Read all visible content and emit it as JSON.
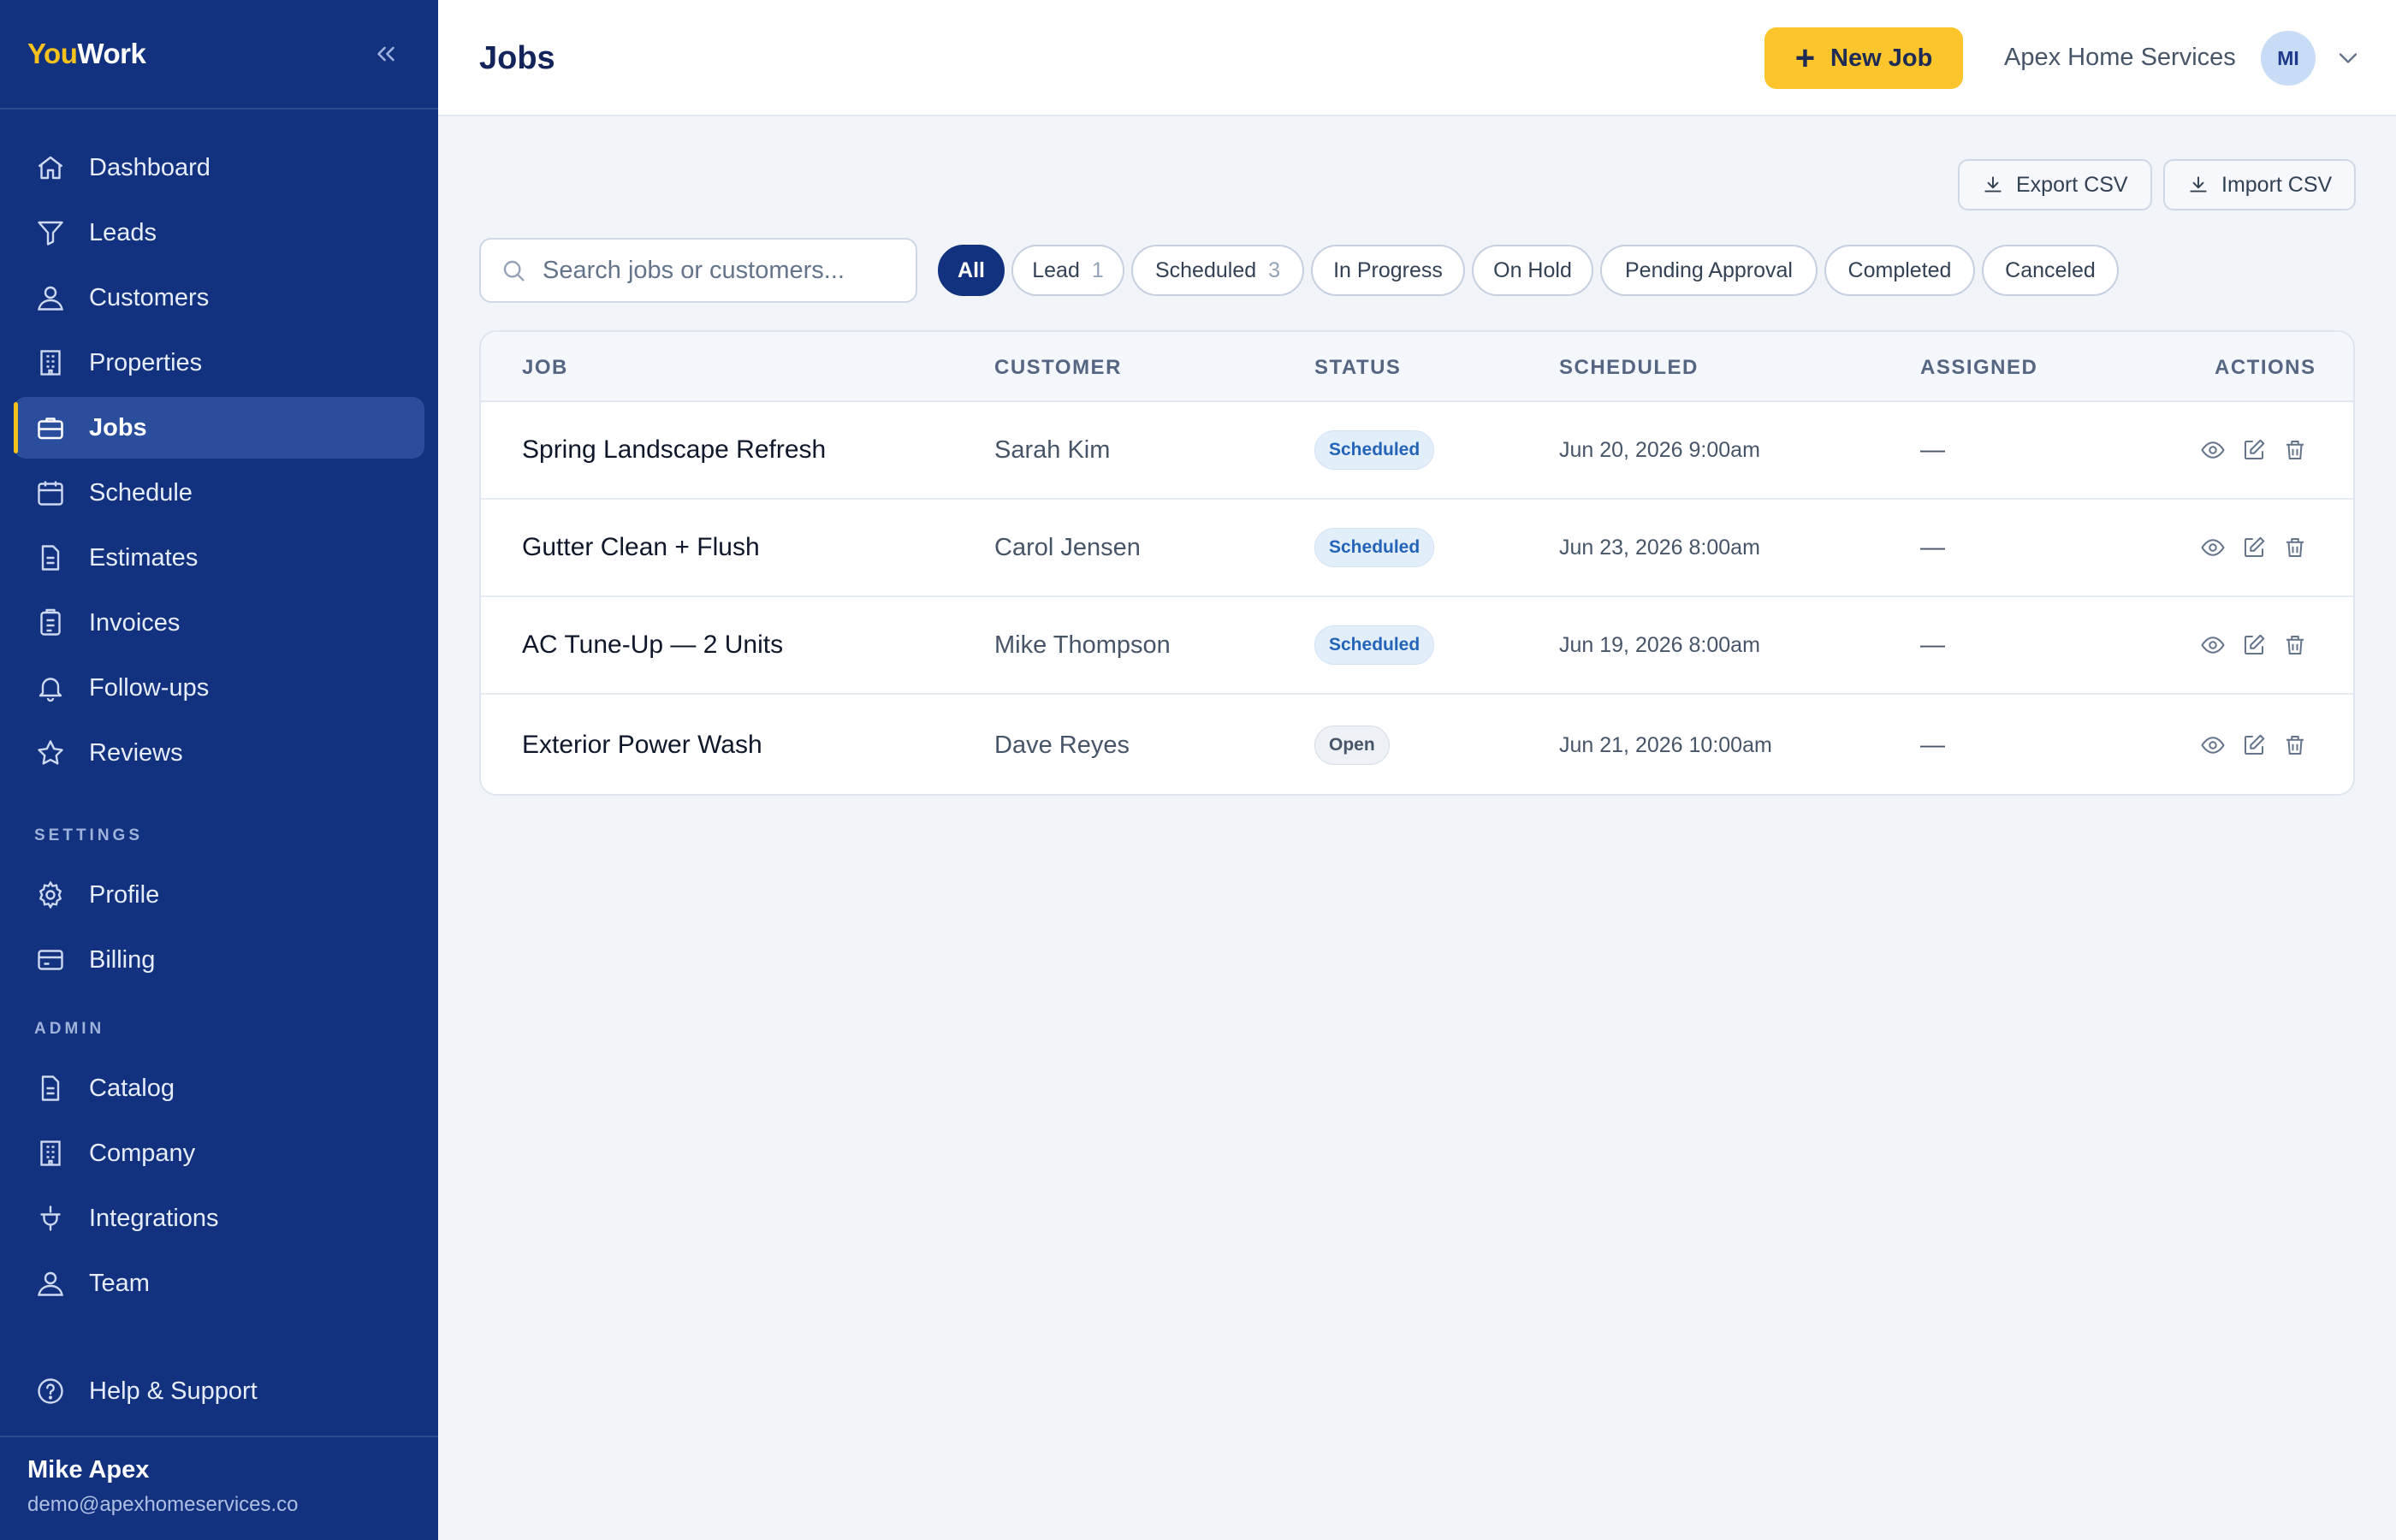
{
  "brand": {
    "part1": "You",
    "part2": "Work"
  },
  "sidebar": {
    "main_items": [
      {
        "label": "Dashboard",
        "icon": "home-icon"
      },
      {
        "label": "Leads",
        "icon": "funnel-icon"
      },
      {
        "label": "Customers",
        "icon": "user-icon"
      },
      {
        "label": "Properties",
        "icon": "building-icon"
      },
      {
        "label": "Jobs",
        "icon": "briefcase-icon",
        "active": true
      },
      {
        "label": "Schedule",
        "icon": "calendar-icon"
      },
      {
        "label": "Estimates",
        "icon": "document-icon"
      },
      {
        "label": "Invoices",
        "icon": "clipboard-icon"
      },
      {
        "label": "Follow-ups",
        "icon": "bell-icon"
      },
      {
        "label": "Reviews",
        "icon": "star-icon"
      }
    ],
    "settings_label": "SETTINGS",
    "settings_items": [
      {
        "label": "Profile",
        "icon": "gear-icon"
      },
      {
        "label": "Billing",
        "icon": "credit-card-icon"
      }
    ],
    "admin_label": "ADMIN",
    "admin_items": [
      {
        "label": "Catalog",
        "icon": "document-icon"
      },
      {
        "label": "Company",
        "icon": "building-icon"
      },
      {
        "label": "Integrations",
        "icon": "plug-icon"
      },
      {
        "label": "Team",
        "icon": "user-icon"
      }
    ],
    "help_label": "Help & Support",
    "user": {
      "name": "Mike Apex",
      "email": "demo@apexhomeservices.co"
    }
  },
  "header": {
    "title": "Jobs",
    "new_job_label": "New Job",
    "company": "Apex Home Services",
    "avatar_initials": "MI"
  },
  "toolbar": {
    "export_label": "Export CSV",
    "import_label": "Import CSV",
    "search_placeholder": "Search jobs or customers..."
  },
  "filters": [
    {
      "label": "All",
      "count": "",
      "active": true
    },
    {
      "label": "Lead",
      "count": "1"
    },
    {
      "label": "Scheduled",
      "count": "3"
    },
    {
      "label": "In Progress",
      "count": ""
    },
    {
      "label": "On Hold",
      "count": ""
    },
    {
      "label": "Pending Approval",
      "count": ""
    },
    {
      "label": "Completed",
      "count": ""
    },
    {
      "label": "Canceled",
      "count": ""
    }
  ],
  "table": {
    "columns": [
      "JOB",
      "CUSTOMER",
      "STATUS",
      "SCHEDULED",
      "ASSIGNED",
      "ACTIONS"
    ],
    "rows": [
      {
        "job": "Spring Landscape Refresh",
        "customer": "Sarah Kim",
        "status": "Scheduled",
        "scheduled": "Jun 20, 2026 9:00am",
        "assigned": "—"
      },
      {
        "job": "Gutter Clean + Flush",
        "customer": "Carol Jensen",
        "status": "Scheduled",
        "scheduled": "Jun 23, 2026 8:00am",
        "assigned": "—"
      },
      {
        "job": "AC Tune-Up — 2 Units",
        "customer": "Mike Thompson",
        "status": "Scheduled",
        "scheduled": "Jun 19, 2026 8:00am",
        "assigned": "—"
      },
      {
        "job": "Exterior Power Wash",
        "customer": "Dave Reyes",
        "status": "Open",
        "scheduled": "Jun 21, 2026 10:00am",
        "assigned": "—"
      }
    ]
  },
  "colors": {
    "sidebar_bg": "#12317f",
    "accent_yellow": "#fbc52b",
    "scheduled_badge": "#2464b8"
  }
}
